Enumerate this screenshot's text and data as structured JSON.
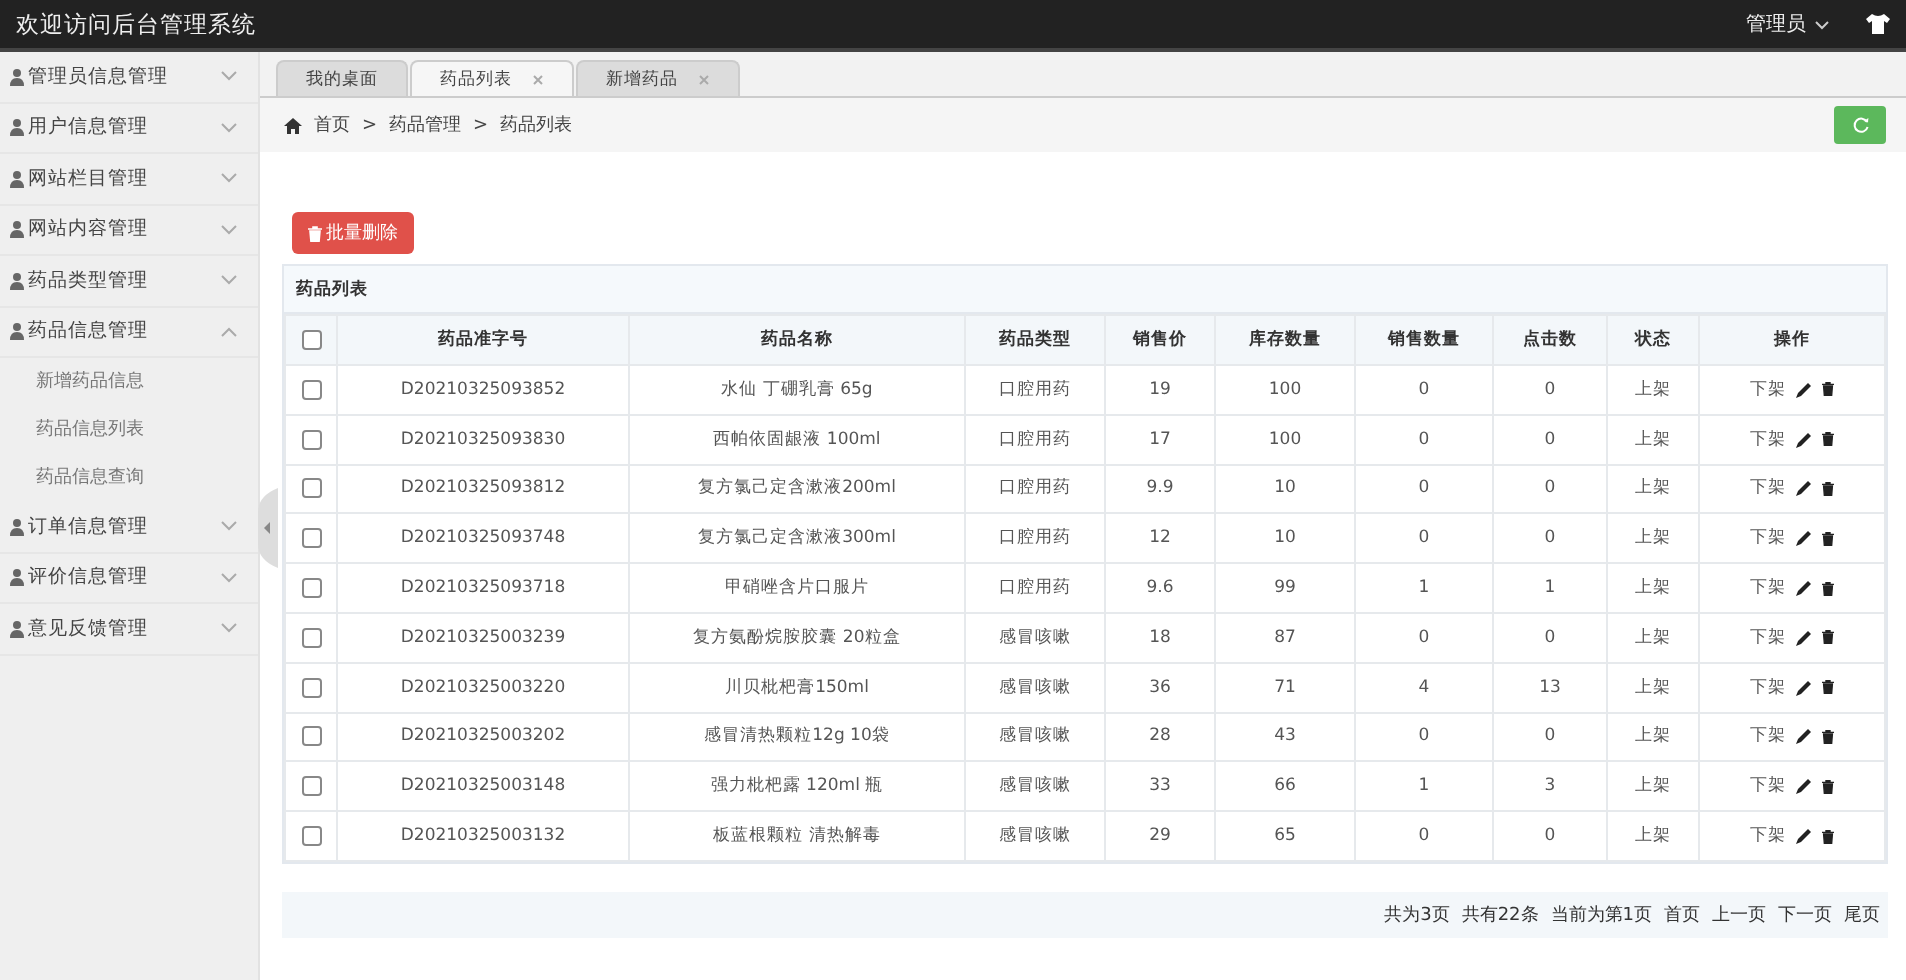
{
  "header": {
    "title": "欢迎访问后台管理系统",
    "user": "管理员"
  },
  "sidebar": {
    "items": [
      {
        "label": "管理员信息管理",
        "expanded": false
      },
      {
        "label": "用户信息管理",
        "expanded": false
      },
      {
        "label": "网站栏目管理",
        "expanded": false
      },
      {
        "label": "网站内容管理",
        "expanded": false
      },
      {
        "label": "药品类型管理",
        "expanded": false
      },
      {
        "label": "药品信息管理",
        "expanded": true,
        "children": [
          {
            "label": "新增药品信息"
          },
          {
            "label": "药品信息列表"
          },
          {
            "label": "药品信息查询"
          }
        ]
      },
      {
        "label": "订单信息管理",
        "expanded": false
      },
      {
        "label": "评价信息管理",
        "expanded": false
      },
      {
        "label": "意见反馈管理",
        "expanded": false
      }
    ]
  },
  "tabs": [
    {
      "label": "我的桌面",
      "selected": false,
      "closable": false
    },
    {
      "label": "药品列表",
      "selected": true,
      "closable": true
    },
    {
      "label": "新增药品",
      "selected": false,
      "closable": true
    }
  ],
  "breadcrumb": {
    "separator": ">",
    "items": [
      "首页",
      "药品管理",
      "药品列表"
    ]
  },
  "batch_delete_button": "批量删除",
  "table": {
    "title": "药品列表",
    "checked_all": false,
    "columns": [
      "药品准字号",
      "药品名称",
      "药品类型",
      "销售价",
      "库存数量",
      "销售数量",
      "点击数",
      "状态",
      "操作"
    ],
    "rows": [
      {
        "checked": false,
        "cells": [
          "D20210325093852",
          "水仙 丁硼乳膏 65g",
          "口腔用药",
          "19",
          "100",
          "0",
          "0",
          "上架"
        ],
        "action": "下架"
      },
      {
        "checked": false,
        "cells": [
          "D20210325093830",
          "西帕依固龈液 100ml",
          "口腔用药",
          "17",
          "100",
          "0",
          "0",
          "上架"
        ],
        "action": "下架"
      },
      {
        "checked": false,
        "cells": [
          "D20210325093812",
          "复方氯己定含漱液200ml",
          "口腔用药",
          "9.9",
          "10",
          "0",
          "0",
          "上架"
        ],
        "action": "下架"
      },
      {
        "checked": false,
        "cells": [
          "D20210325093748",
          "复方氯己定含漱液300ml",
          "口腔用药",
          "12",
          "10",
          "0",
          "0",
          "上架"
        ],
        "action": "下架"
      },
      {
        "checked": false,
        "cells": [
          "D20210325093718",
          "甲硝唑含片口服片",
          "口腔用药",
          "9.6",
          "99",
          "1",
          "1",
          "上架"
        ],
        "action": "下架"
      },
      {
        "checked": false,
        "cells": [
          "D20210325003239",
          "复方氨酚烷胺胶囊 20粒盒",
          "感冒咳嗽",
          "18",
          "87",
          "0",
          "0",
          "上架"
        ],
        "action": "下架"
      },
      {
        "checked": false,
        "cells": [
          "D20210325003220",
          "川贝枇杷膏150ml",
          "感冒咳嗽",
          "36",
          "71",
          "4",
          "13",
          "上架"
        ],
        "action": "下架"
      },
      {
        "checked": false,
        "cells": [
          "D20210325003202",
          "感冒清热颗粒12g 10袋",
          "感冒咳嗽",
          "28",
          "43",
          "0",
          "0",
          "上架"
        ],
        "action": "下架"
      },
      {
        "checked": false,
        "cells": [
          "D20210325003148",
          "强力枇杷露 120ml 瓶",
          "感冒咳嗽",
          "33",
          "66",
          "1",
          "3",
          "上架"
        ],
        "action": "下架"
      },
      {
        "checked": false,
        "cells": [
          "D20210325003132",
          "板蓝根颗粒 清热解毒",
          "感冒咳嗽",
          "29",
          "65",
          "0",
          "0",
          "上架"
        ],
        "action": "下架"
      }
    ]
  },
  "pager": {
    "info": [
      "共为3页",
      "共有22条",
      "当前为第1页"
    ],
    "links": [
      "首页",
      "上一页",
      "下一页",
      "尾页"
    ]
  }
}
